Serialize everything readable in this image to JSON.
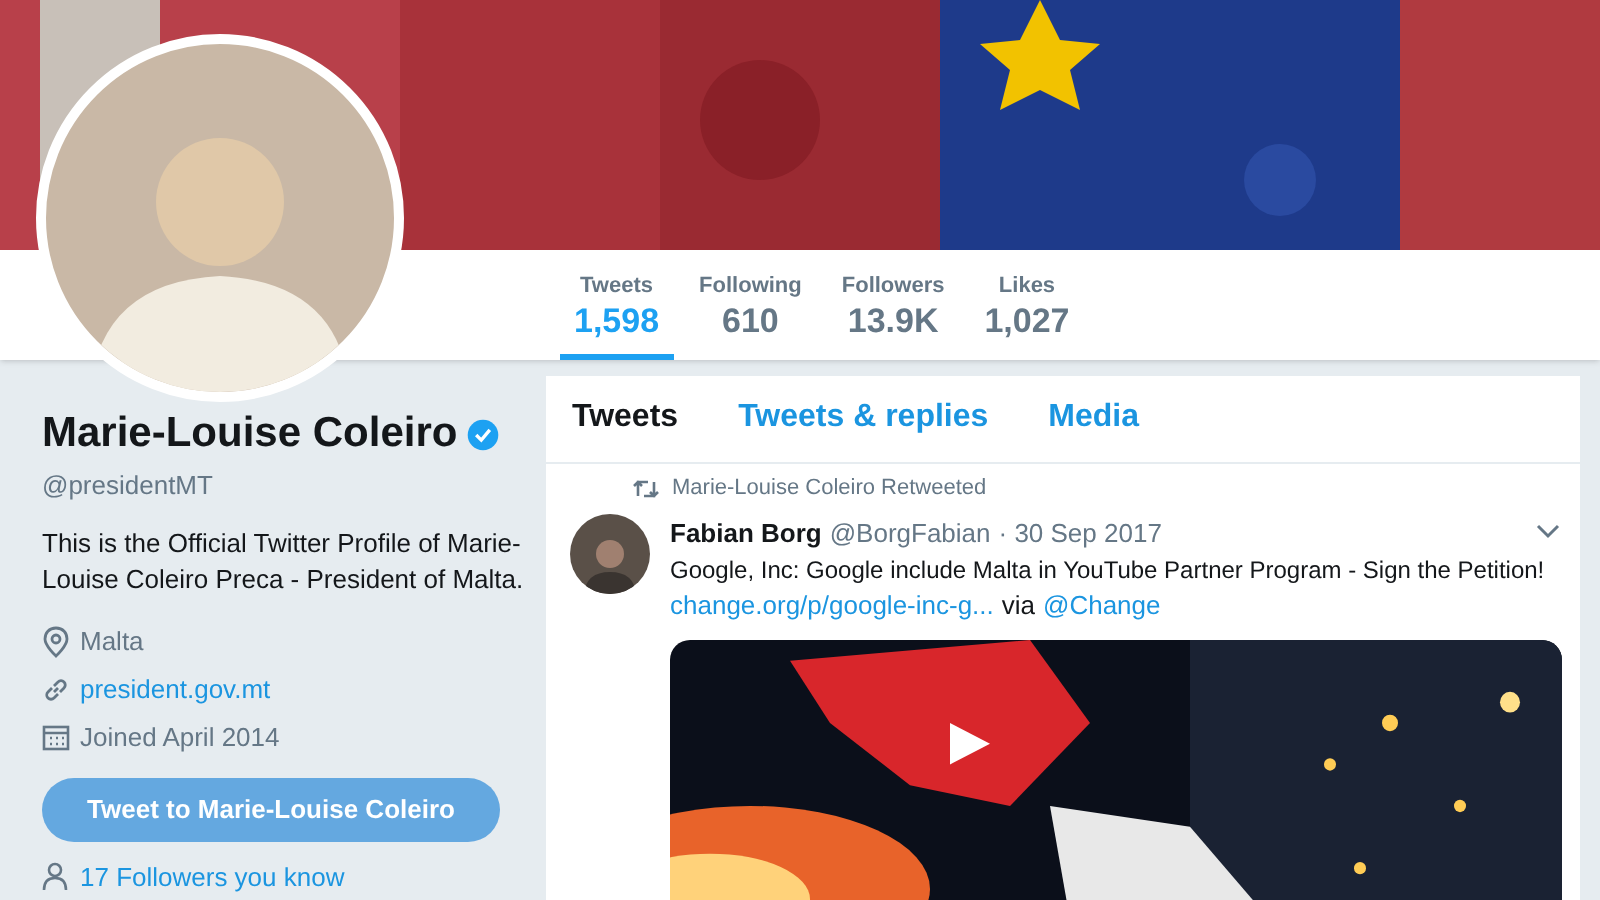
{
  "profile": {
    "name": "Marie-Louise Coleiro",
    "verified": true,
    "handle": "@presidentMT",
    "bio": "This is the Official Twitter Profile of Marie-Louise Coleiro Preca - President of Malta.",
    "location": "Malta",
    "website": "president.gov.mt",
    "joined": "Joined April 2014",
    "tweet_button": "Tweet to Marie-Louise Coleiro",
    "followers_you_know": "17 Followers you know"
  },
  "stats": [
    {
      "label": "Tweets",
      "value": "1,598",
      "selected": true
    },
    {
      "label": "Following",
      "value": "610",
      "selected": false
    },
    {
      "label": "Followers",
      "value": "13.9K",
      "selected": false
    },
    {
      "label": "Likes",
      "value": "1,027",
      "selected": false
    }
  ],
  "timeline_tabs": [
    {
      "label": "Tweets",
      "selected": true
    },
    {
      "label": "Tweets & replies",
      "selected": false
    },
    {
      "label": "Media",
      "selected": false
    }
  ],
  "tweets": [
    {
      "retweeted_by": "Marie-Louise Coleiro Retweeted",
      "author": "Fabian Borg",
      "handle": "@BorgFabian",
      "date": "· 30 Sep 2017",
      "text": "Google, Inc: Google include Malta in YouTube Partner Program - Sign the Petition!",
      "link": "change.org/p/google-inc-g...",
      "via": "via",
      "mention": "@Change"
    }
  ]
}
